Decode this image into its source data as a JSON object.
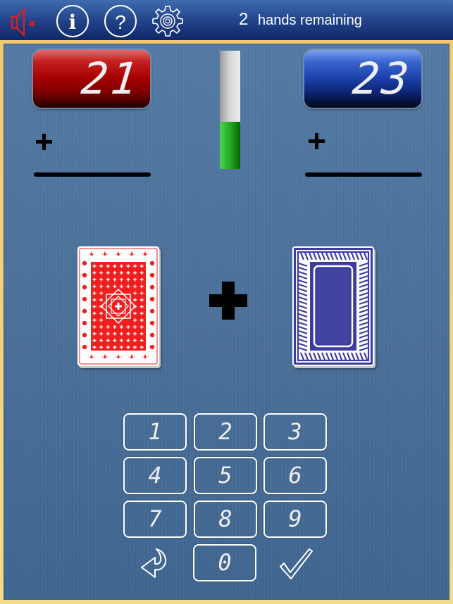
{
  "header": {
    "icons": [
      {
        "name": "sound-muted-icon",
        "color": "#e01e1e"
      },
      {
        "name": "info-icon",
        "glyph": "i"
      },
      {
        "name": "help-icon",
        "glyph": "?"
      },
      {
        "name": "settings-gear-icon"
      }
    ],
    "hands_count": "2",
    "hands_label": "hands remaining"
  },
  "players": {
    "red": {
      "score": "21",
      "color": "#a40000",
      "operator": "+"
    },
    "blue": {
      "score": "23",
      "color": "#1b3fa8",
      "operator": "+"
    }
  },
  "timer": {
    "remaining_fraction": 0.4,
    "fill_color": "#26a826"
  },
  "cards": {
    "left": {
      "back_color": "#f01e1e",
      "face": "down"
    },
    "right": {
      "back_color": "#3c3ca0",
      "face": "down"
    },
    "operator": "+"
  },
  "keypad": {
    "keys": [
      "1",
      "2",
      "3",
      "4",
      "5",
      "6",
      "7",
      "8",
      "9"
    ],
    "zero": "0",
    "back_icon": "undo-arrow-icon",
    "submit_icon": "checkmark-icon"
  },
  "colors": {
    "header_top": "#3f6cb0",
    "header_bottom": "#0f2868",
    "board": "#4a6f98",
    "frame": "#f0d27e"
  }
}
